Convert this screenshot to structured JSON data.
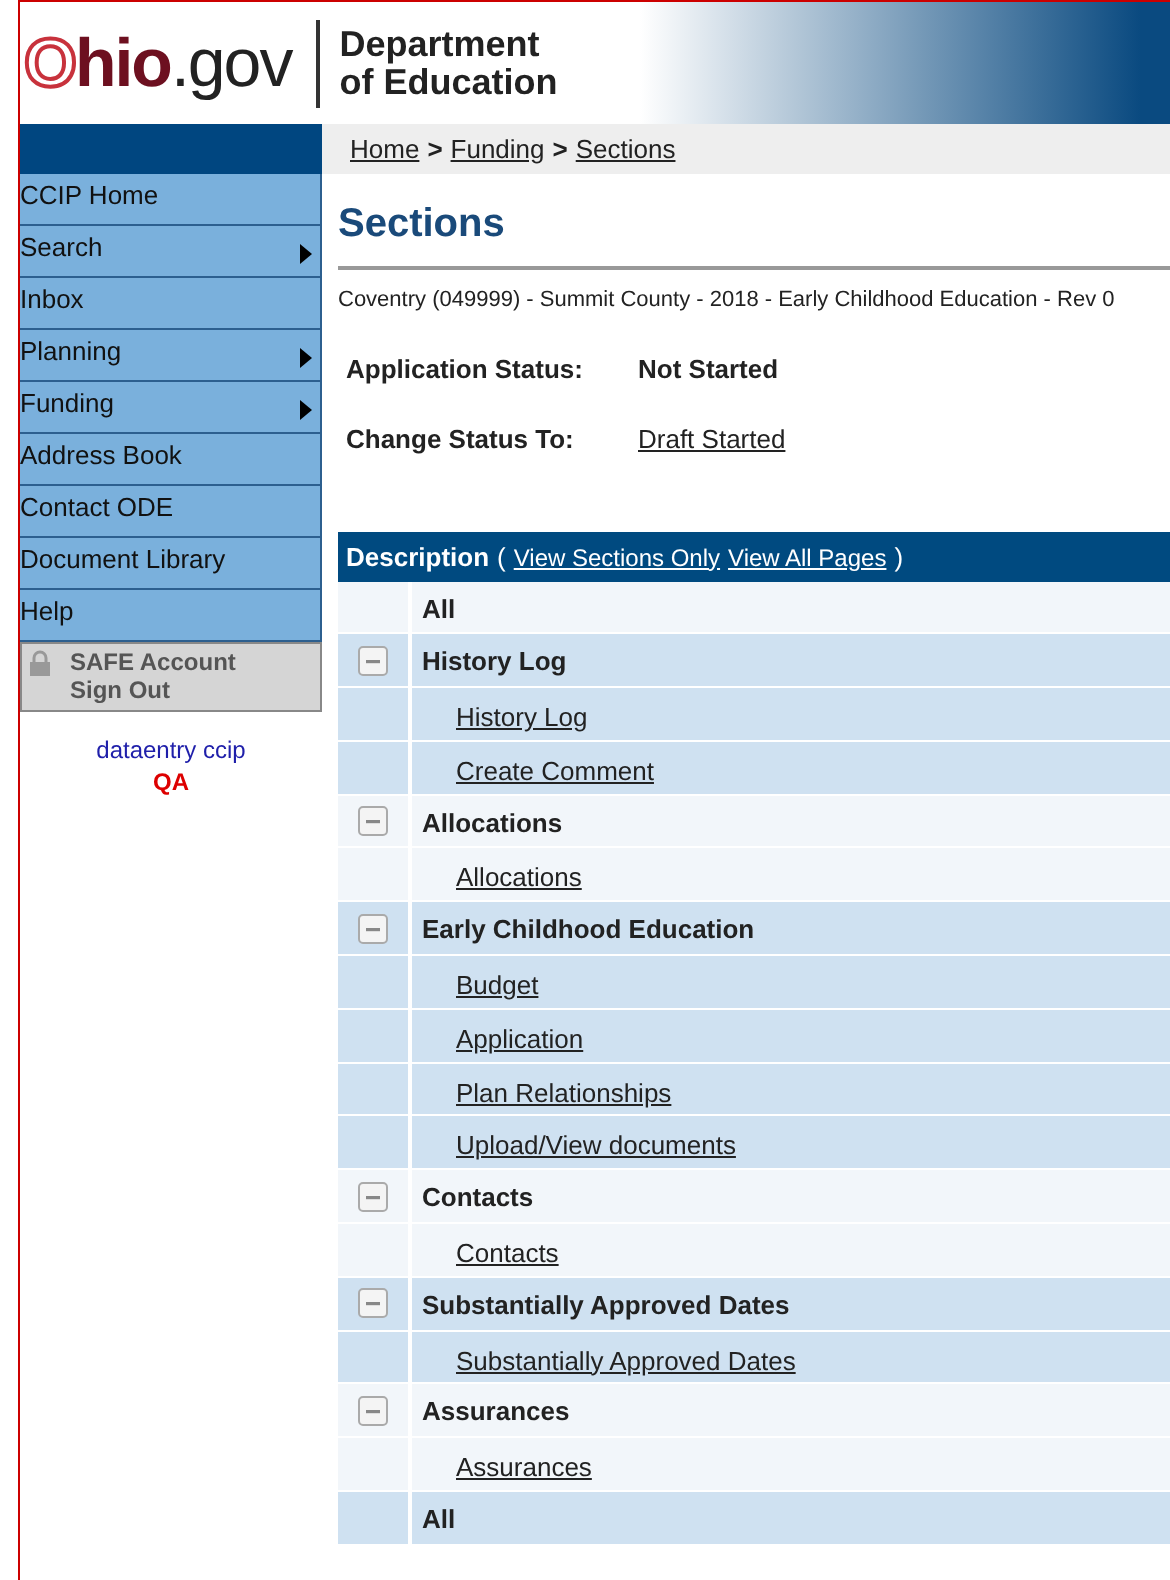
{
  "header": {
    "logo": {
      "first": "O",
      "second": "hio",
      "third": ".gov"
    },
    "department": [
      "Department",
      "of Education"
    ]
  },
  "breadcrumb": [
    {
      "label": "Home"
    },
    {
      "separator": ">"
    },
    {
      "label": "Funding"
    },
    {
      "separator": ">"
    },
    {
      "label": "Sections"
    }
  ],
  "sidebar": {
    "items": [
      {
        "label": "CCIP Home",
        "submenu": false
      },
      {
        "label": "Search",
        "submenu": true
      },
      {
        "label": "Inbox",
        "submenu": false
      },
      {
        "label": "Planning",
        "submenu": true
      },
      {
        "label": "Funding",
        "submenu": true
      },
      {
        "label": "Address Book",
        "submenu": false
      },
      {
        "label": "Contact ODE",
        "submenu": false
      },
      {
        "label": "Document Library",
        "submenu": false
      },
      {
        "label": "Help",
        "submenu": false
      }
    ],
    "account": [
      "SAFE Account",
      "Sign Out"
    ],
    "user": "dataentry ccip",
    "environment": "QA"
  },
  "title": "Sections",
  "context": "Coventry (049999) - Summit County - 2018 - Early Childhood Education - Rev 0",
  "status": [
    {
      "label": "Application Status:",
      "value": "Not Started",
      "kind": "text"
    },
    {
      "label": "Change Status To:",
      "value": "Draft Started",
      "kind": "link"
    }
  ],
  "table": {
    "heading": "Description",
    "open": "(",
    "links": [
      "View Sections Only",
      "View All Pages"
    ],
    "close": ")",
    "rows": [
      {
        "kind": "all",
        "label": "All"
      },
      {
        "kind": "section",
        "label": "History Log",
        "expanded": true,
        "children": [
          {
            "label": "History Log"
          },
          {
            "label": "Create Comment"
          }
        ]
      },
      {
        "kind": "section",
        "label": "Allocations",
        "expanded": true,
        "children": [
          {
            "label": "Allocations"
          }
        ]
      },
      {
        "kind": "section",
        "label": "Early Childhood Education",
        "expanded": true,
        "children": [
          {
            "label": "Budget"
          },
          {
            "label": "Application"
          },
          {
            "label": "Plan Relationships"
          },
          {
            "label": "Upload/View documents"
          }
        ]
      },
      {
        "kind": "section",
        "label": "Contacts",
        "expanded": true,
        "children": [
          {
            "label": "Contacts"
          }
        ]
      },
      {
        "kind": "section",
        "label": "Substantially Approved Dates",
        "expanded": true,
        "children": [
          {
            "label": "Substantially Approved Dates"
          }
        ]
      },
      {
        "kind": "section",
        "label": "Assurances",
        "expanded": true,
        "children": [
          {
            "label": "Assurances"
          }
        ]
      },
      {
        "kind": "all",
        "label": "All"
      }
    ]
  }
}
